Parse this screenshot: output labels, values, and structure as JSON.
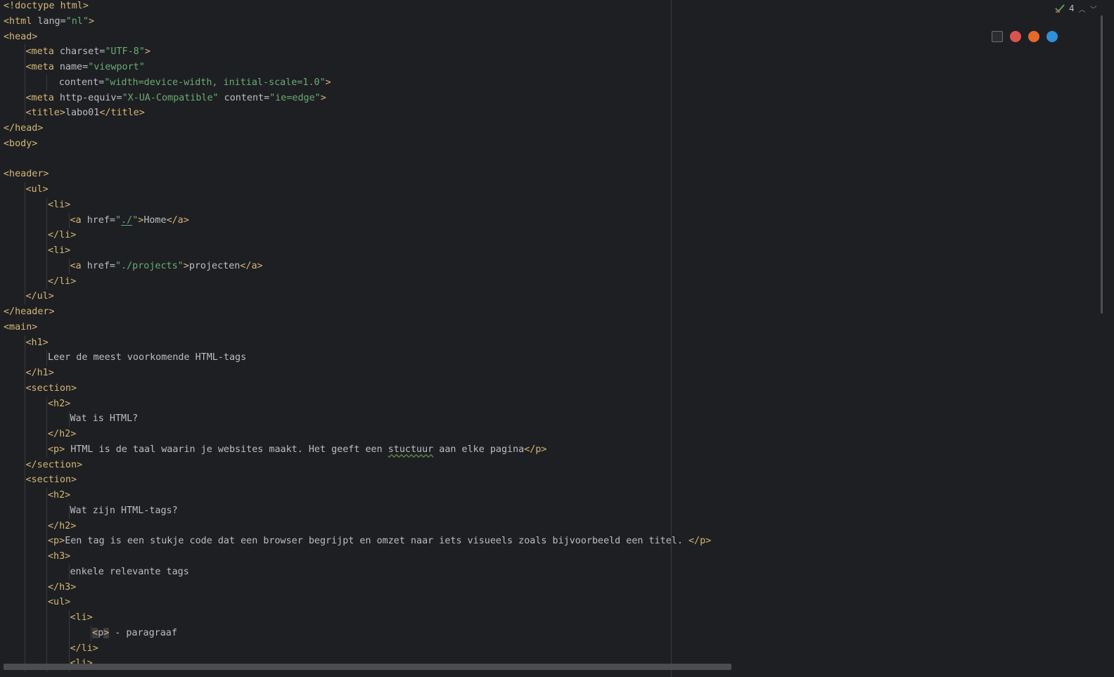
{
  "editor": {
    "inspection": {
      "count": "4",
      "icon": "check-warning-icon"
    },
    "browsers": [
      {
        "name": "phpstorm-icon",
        "color": "#2b2d30"
      },
      {
        "name": "chrome-icon",
        "color": "#d9534f"
      },
      {
        "name": "firefox-icon",
        "color": "#e56a2a"
      },
      {
        "name": "edge-icon",
        "color": "#2f8fd8"
      }
    ],
    "lines": [
      {
        "indent": 0,
        "tokens": [
          [
            "tag",
            "<!doctype html>"
          ]
        ]
      },
      {
        "indent": 0,
        "tokens": [
          [
            "tag",
            "<html "
          ],
          [
            "attr",
            "lang="
          ],
          [
            "val",
            "\"nl\""
          ],
          [
            "tag",
            ">"
          ]
        ]
      },
      {
        "indent": 0,
        "tokens": [
          [
            "tag",
            "<head>"
          ]
        ]
      },
      {
        "indent": 1,
        "tokens": [
          [
            "tag",
            "<meta "
          ],
          [
            "attr",
            "charset="
          ],
          [
            "val",
            "\"UTF-8\""
          ],
          [
            "tag",
            ">"
          ]
        ]
      },
      {
        "indent": 1,
        "tokens": [
          [
            "tag",
            "<meta "
          ],
          [
            "attr",
            "name="
          ],
          [
            "val",
            "\"viewport\""
          ]
        ]
      },
      {
        "indent": 2.5,
        "tokens": [
          [
            "attr",
            "content="
          ],
          [
            "val",
            "\"width=device-width, initial-scale=1.0\""
          ],
          [
            "tag",
            ">"
          ]
        ]
      },
      {
        "indent": 1,
        "tokens": [
          [
            "tag",
            "<meta "
          ],
          [
            "attr",
            "http-equiv="
          ],
          [
            "val",
            "\"X-UA-Compatible\""
          ],
          [
            "attr",
            " content="
          ],
          [
            "val",
            "\"ie=edge\""
          ],
          [
            "tag",
            ">"
          ]
        ]
      },
      {
        "indent": 1,
        "tokens": [
          [
            "tag",
            "<title>"
          ],
          [
            "text",
            "labo01"
          ],
          [
            "tag",
            "</title>"
          ]
        ]
      },
      {
        "indent": 0,
        "tokens": [
          [
            "tag",
            "</head>"
          ]
        ]
      },
      {
        "indent": 0,
        "tokens": [
          [
            "tag",
            "<body>"
          ]
        ]
      },
      {
        "indent": 0,
        "tokens": []
      },
      {
        "indent": 0,
        "tokens": [
          [
            "tag",
            "<header>"
          ]
        ]
      },
      {
        "indent": 1,
        "tokens": [
          [
            "tag",
            "<ul>"
          ]
        ]
      },
      {
        "indent": 2,
        "tokens": [
          [
            "tag",
            "<li>"
          ]
        ]
      },
      {
        "indent": 3,
        "tokens": [
          [
            "tag",
            "<a "
          ],
          [
            "attr",
            "href="
          ],
          [
            "val",
            "\""
          ],
          [
            "val-u",
            "./"
          ],
          [
            "val",
            "\""
          ],
          [
            "tag",
            ">"
          ],
          [
            "text",
            "Home"
          ],
          [
            "tag",
            "</a>"
          ]
        ]
      },
      {
        "indent": 2,
        "tokens": [
          [
            "tag",
            "</li>"
          ]
        ]
      },
      {
        "indent": 2,
        "tokens": [
          [
            "tag",
            "<li>"
          ]
        ]
      },
      {
        "indent": 3,
        "tokens": [
          [
            "tag",
            "<a "
          ],
          [
            "attr",
            "href="
          ],
          [
            "val",
            "\"./projects\""
          ],
          [
            "tag",
            ">"
          ],
          [
            "text",
            "projecten"
          ],
          [
            "tag",
            "</a>"
          ]
        ]
      },
      {
        "indent": 2,
        "tokens": [
          [
            "tag",
            "</li>"
          ]
        ]
      },
      {
        "indent": 1,
        "tokens": [
          [
            "tag",
            "</ul>"
          ]
        ]
      },
      {
        "indent": 0,
        "tokens": [
          [
            "tag",
            "</header>"
          ]
        ]
      },
      {
        "indent": 0,
        "tokens": [
          [
            "tag",
            "<main>"
          ]
        ]
      },
      {
        "indent": 1,
        "tokens": [
          [
            "tag",
            "<h1>"
          ]
        ]
      },
      {
        "indent": 2,
        "tokens": [
          [
            "text",
            "Leer de meest voorkomende HTML-tags"
          ]
        ]
      },
      {
        "indent": 1,
        "tokens": [
          [
            "tag",
            "</h1>"
          ]
        ]
      },
      {
        "indent": 1,
        "tokens": [
          [
            "tag",
            "<section>"
          ]
        ]
      },
      {
        "indent": 2,
        "tokens": [
          [
            "tag",
            "<h2>"
          ]
        ]
      },
      {
        "indent": 3,
        "tokens": [
          [
            "text",
            "Wat is HTML?"
          ]
        ]
      },
      {
        "indent": 2,
        "tokens": [
          [
            "tag",
            "</h2>"
          ]
        ]
      },
      {
        "indent": 2,
        "tokens": [
          [
            "tag",
            "<p>"
          ],
          [
            "text",
            " HTML is de taal waarin je websites maakt. Het geeft een "
          ],
          [
            "typo",
            "stuctuur"
          ],
          [
            "text",
            " aan elke pagina"
          ],
          [
            "tag",
            "</p>"
          ]
        ]
      },
      {
        "indent": 1,
        "tokens": [
          [
            "tag",
            "</section>"
          ]
        ]
      },
      {
        "indent": 1,
        "tokens": [
          [
            "tag",
            "<section>"
          ]
        ]
      },
      {
        "indent": 2,
        "tokens": [
          [
            "tag",
            "<h2>"
          ]
        ]
      },
      {
        "indent": 3,
        "tokens": [
          [
            "text",
            "Wat zijn HTML-tags?"
          ]
        ]
      },
      {
        "indent": 2,
        "tokens": [
          [
            "tag",
            "</h2>"
          ]
        ]
      },
      {
        "indent": 2,
        "tokens": [
          [
            "tag",
            "<p>"
          ],
          [
            "text",
            "Een tag is een stukje code dat een browser begrijpt en omzet naar iets visueels zoals bijvoorbeeld een titel. "
          ],
          [
            "tag",
            "</p>"
          ]
        ]
      },
      {
        "indent": 2,
        "tokens": [
          [
            "tag",
            "<h3>"
          ]
        ]
      },
      {
        "indent": 3,
        "tokens": [
          [
            "text",
            "enkele relevante tags"
          ]
        ]
      },
      {
        "indent": 2,
        "tokens": [
          [
            "tag",
            "</h3>"
          ]
        ]
      },
      {
        "indent": 2,
        "tokens": [
          [
            "tag",
            "<ul>"
          ]
        ]
      },
      {
        "indent": 3,
        "tokens": [
          [
            "tag",
            "<li>"
          ]
        ]
      },
      {
        "indent": 4,
        "tokens": [
          [
            "hl",
            "<"
          ],
          [
            "text",
            "p"
          ],
          [
            "hl",
            ">"
          ],
          [
            "text",
            " - paragraaf"
          ]
        ]
      },
      {
        "indent": 3,
        "tokens": [
          [
            "tag",
            "</li>"
          ]
        ]
      },
      {
        "indent": 3,
        "tokens": [
          [
            "tag",
            "<li>"
          ]
        ]
      }
    ]
  }
}
